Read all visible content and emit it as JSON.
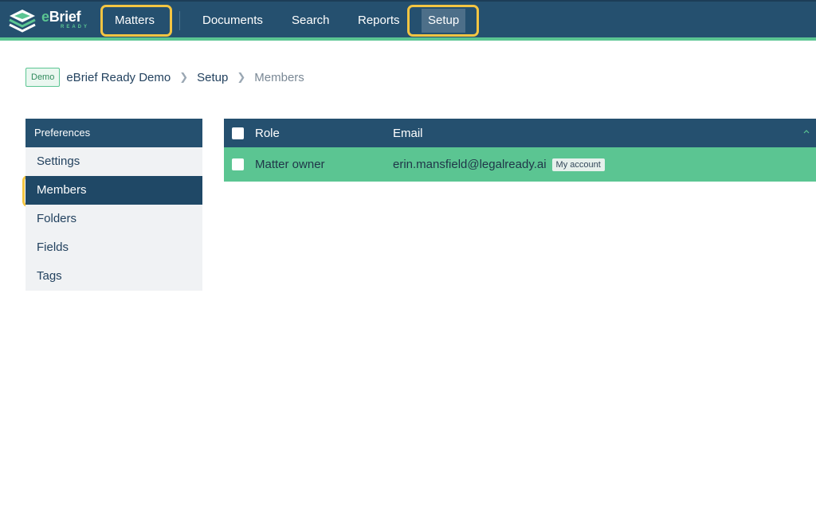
{
  "app": {
    "logo_word_prefix": "e",
    "logo_word_rest": "Brief",
    "logo_sub": "READY"
  },
  "nav": {
    "items": [
      {
        "label": "Matters"
      },
      {
        "label": "Documents"
      },
      {
        "label": "Search"
      },
      {
        "label": "Reports"
      },
      {
        "label": "Setup",
        "active": true
      }
    ]
  },
  "breadcrumb": {
    "badge": "Demo",
    "items": [
      "eBrief Ready Demo",
      "Setup",
      "Members"
    ]
  },
  "sidebar": {
    "header": "Preferences",
    "items": [
      {
        "label": "Settings"
      },
      {
        "label": "Members",
        "active": true
      },
      {
        "label": "Folders"
      },
      {
        "label": "Fields"
      },
      {
        "label": "Tags"
      }
    ]
  },
  "table": {
    "columns": [
      "Role",
      "Email"
    ],
    "rows": [
      {
        "role": "Matter owner",
        "email": "erin.mansfield@legalready.ai",
        "badge": "My account"
      }
    ]
  },
  "colors": {
    "navbar": "#25506f",
    "accent": "#5bc592",
    "highlight": "#f4c542"
  }
}
